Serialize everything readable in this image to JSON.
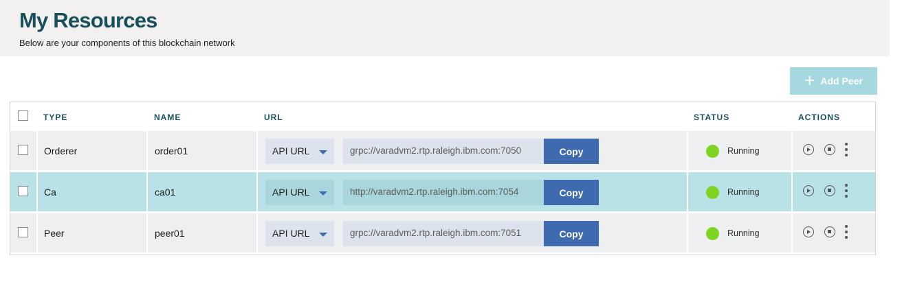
{
  "header": {
    "title": "My Resources",
    "subtitle": "Below are your components of this blockchain network"
  },
  "add_peer": {
    "icon": "plus-icon",
    "label": "Add Peer"
  },
  "table": {
    "columns": {
      "type": "TYPE",
      "name": "NAME",
      "url": "URL",
      "status": "STATUS",
      "actions": "ACTIONS"
    },
    "rows": [
      {
        "type": "Orderer",
        "name": "order01",
        "url_select": "API URL",
        "url": "grpc://varadvm2.rtp.raleigh.ibm.com:7050",
        "copy": "Copy",
        "status": "Running",
        "selected": false
      },
      {
        "type": "Ca",
        "name": "ca01",
        "url_select": "API URL",
        "url": "http://varadvm2.rtp.raleigh.ibm.com:7054",
        "copy": "Copy",
        "status": "Running",
        "selected": true
      },
      {
        "type": "Peer",
        "name": "peer01",
        "url_select": "API URL",
        "url": "grpc://varadvm2.rtp.raleigh.ibm.com:7051",
        "copy": "Copy",
        "status": "Running",
        "selected": false
      }
    ]
  },
  "colors": {
    "title": "#17505c",
    "selected_row": "#b8e2e6",
    "copy_button": "#3f6ab0",
    "status_running": "#7ed321",
    "add_peer_button": "#a6d8e0"
  }
}
